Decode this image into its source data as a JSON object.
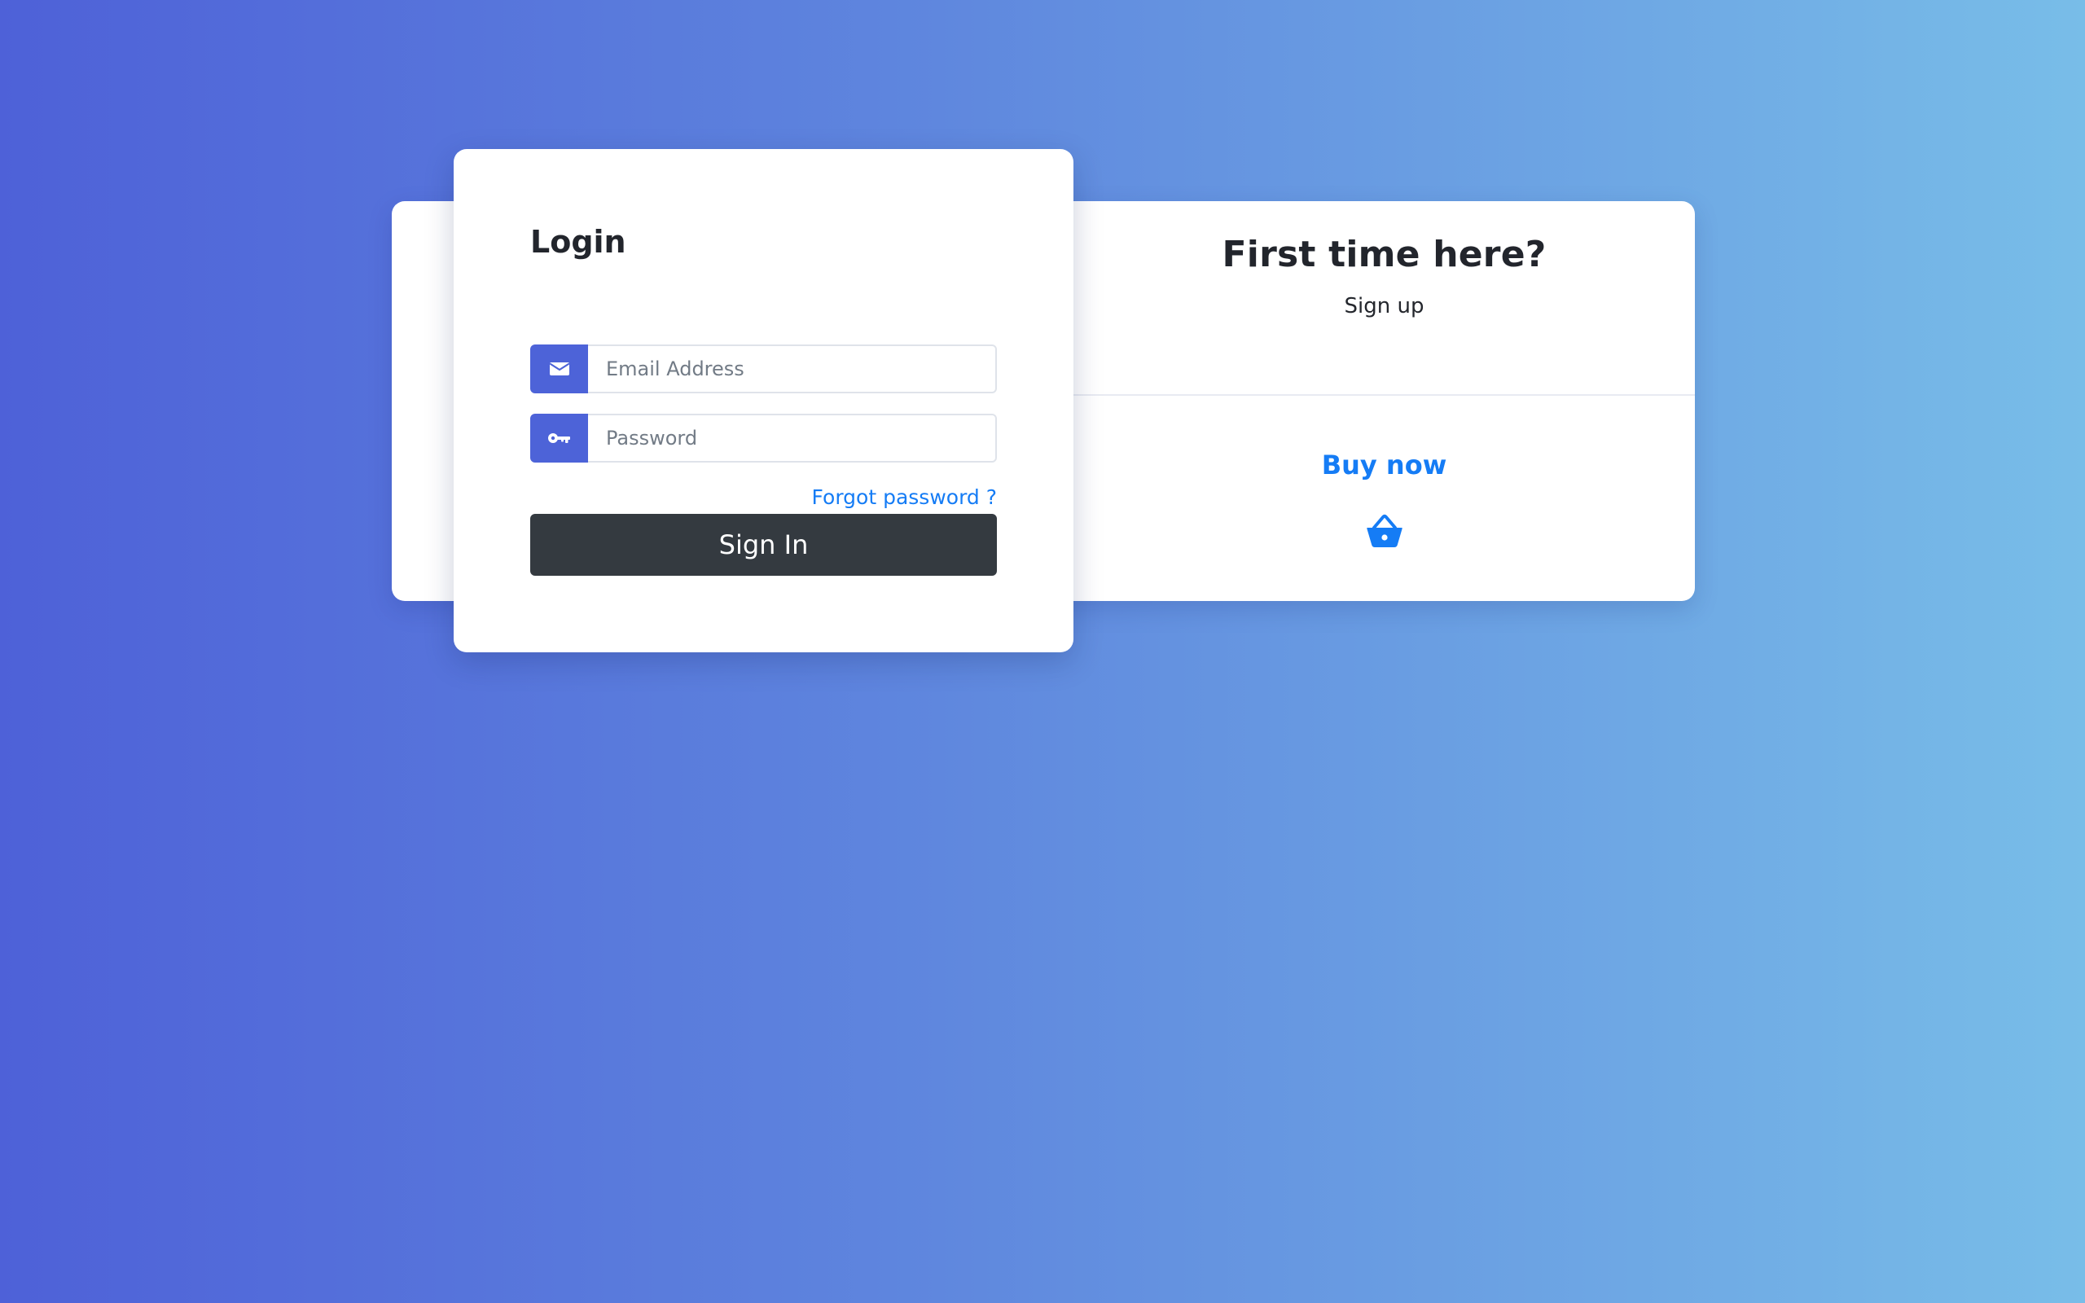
{
  "login": {
    "title": "Login",
    "email": {
      "placeholder": "Email Address",
      "value": "",
      "icon": "envelope-icon"
    },
    "password": {
      "placeholder": "Password",
      "value": "",
      "icon": "key-icon"
    },
    "forgot_label": "Forgot password ?",
    "submit_label": "Sign In"
  },
  "signup_panel": {
    "title": "First time here?",
    "subtitle": "Sign up",
    "buy_label": "Buy now",
    "buy_icon": "basket-icon"
  },
  "colors": {
    "accent": "#4d63d8",
    "link": "#157cf5",
    "button": "#343a40",
    "background_start": "#4e61d8",
    "background_end": "#78bde8"
  }
}
